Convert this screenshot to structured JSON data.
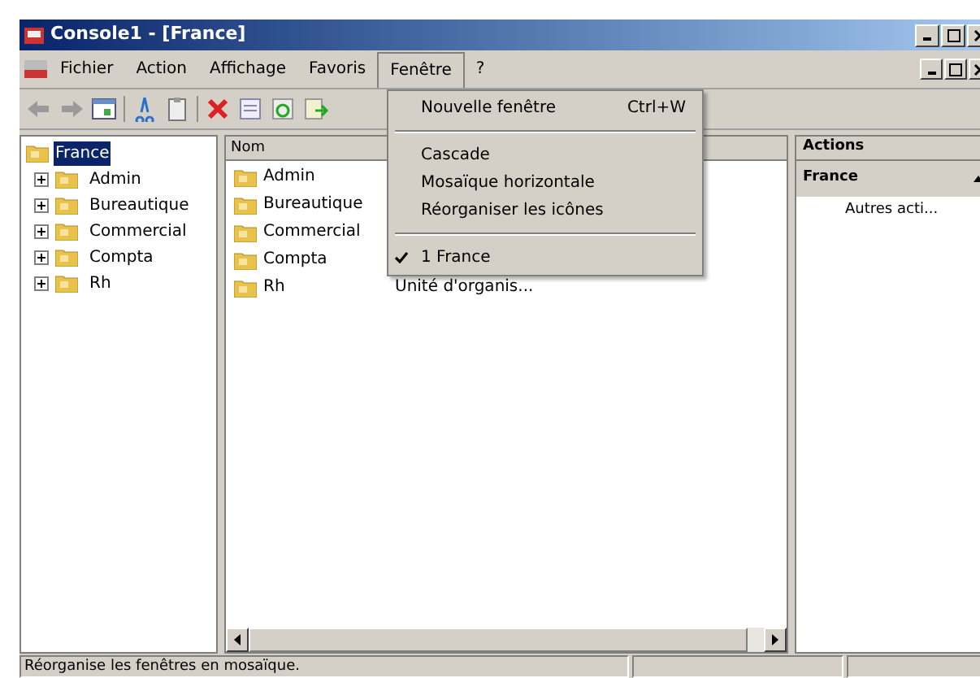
{
  "window": {
    "title": "Console1 - [France]"
  },
  "menu": [
    {
      "label": "Fichier",
      "selected": false
    },
    {
      "label": "Action",
      "selected": false
    },
    {
      "label": "Affichage",
      "selected": false
    },
    {
      "label": "Favoris",
      "selected": false
    },
    {
      "label": "Fenêtre",
      "selected": true
    },
    {
      "label": "?",
      "selected": false
    }
  ],
  "dropdown": [
    {
      "kind": "item",
      "label": "Nouvelle fenêtre",
      "shortcut": "Ctrl+W",
      "checked": false
    },
    {
      "kind": "separator"
    },
    {
      "kind": "item",
      "label": "Cascade",
      "checked": false
    },
    {
      "kind": "item",
      "label": "Mosaïque horizontale",
      "checked": false
    },
    {
      "kind": "item",
      "label": "Réorganiser les icônes",
      "checked": false
    },
    {
      "kind": "separator"
    },
    {
      "kind": "item",
      "label": "1 France",
      "checked": true
    }
  ],
  "tree": {
    "label": "France",
    "selected": true,
    "expanded": true,
    "children": [
      {
        "label": "Admin",
        "expanded": false,
        "selected": false
      },
      {
        "label": "Bureautique",
        "expanded": false,
        "selected": false
      },
      {
        "label": "Commercial",
        "expanded": false,
        "selected": false
      },
      {
        "label": "Compta",
        "expanded": false,
        "selected": false
      },
      {
        "label": "Rh",
        "expanded": false,
        "selected": false
      }
    ]
  },
  "list": {
    "columns": [
      "Nom"
    ],
    "rows": [
      {
        "name": "Admin"
      },
      {
        "name": "Bureautique"
      },
      {
        "name": "Commercial"
      },
      {
        "name": "Compta"
      },
      {
        "name": "Rh",
        "type": "Unité d'organis..."
      }
    ]
  },
  "actions": {
    "title": "Actions",
    "section": "France",
    "items": [
      "Autres acti..."
    ]
  },
  "status_bar": [
    "Réorganise les fenêtres en mosaïque."
  ]
}
